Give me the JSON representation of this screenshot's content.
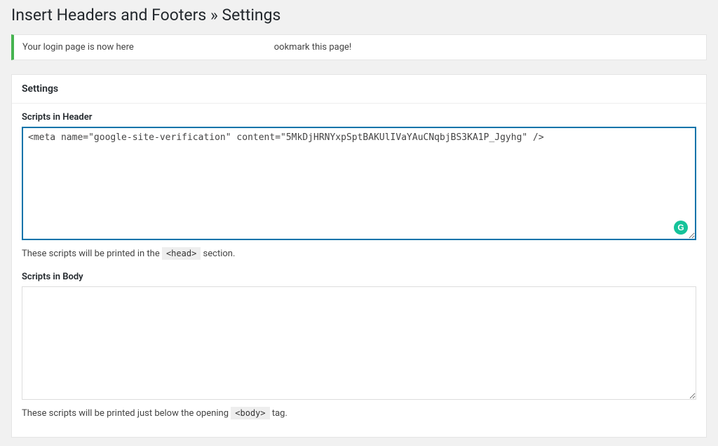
{
  "page": {
    "title": "Insert Headers and Footers » Settings"
  },
  "notice": {
    "prefix": "Your login page is now here",
    "suffix": "ookmark this page!"
  },
  "panel": {
    "heading": "Settings",
    "header": {
      "label": "Scripts in Header",
      "value": "<meta name=\"google-site-verification\" content=\"5MkDjHRNYxpSptBAKUlIVaYAuCNqbjBS3KA1P_Jgyhg\" />",
      "help_prefix": "These scripts will be printed in the ",
      "help_tag": "<head>",
      "help_suffix": " section."
    },
    "body": {
      "label": "Scripts in Body",
      "value": "",
      "help_prefix": "These scripts will be printed just below the opening ",
      "help_tag": "<body>",
      "help_suffix": " tag."
    }
  },
  "icons": {
    "grammarly_letter": "G"
  }
}
